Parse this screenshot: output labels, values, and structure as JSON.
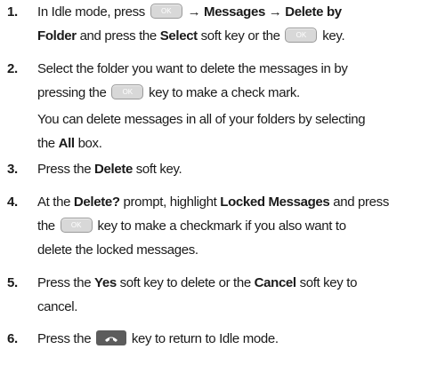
{
  "keys": {
    "ok": "OK",
    "end": "end-key-icon"
  },
  "steps": [
    {
      "num": "1.",
      "l1": {
        "a": "In Idle mode, press",
        "b": "→ Messages → Delete by"
      },
      "l2": {
        "a": "Folder",
        "b": " and press the ",
        "c": "Select",
        "d": " soft key or the ",
        "e": " key."
      }
    },
    {
      "num": "2.",
      "l1": "Select the folder you want to delete the messages in by",
      "l2": {
        "a": "pressing the ",
        "b": " key to make a check mark."
      },
      "sub1": "You can delete messages in all of your folders by selecting",
      "sub2": {
        "a": "the ",
        "b": "All",
        "c": " box."
      }
    },
    {
      "num": "3.",
      "l1": {
        "a": "Press the ",
        "b": "Delete",
        "c": " soft key."
      }
    },
    {
      "num": "4.",
      "l1": {
        "a": "At the ",
        "b": "Delete?",
        "c": " prompt, highlight ",
        "d": "Locked Messages",
        "e": " and press"
      },
      "l2": {
        "a": "the ",
        "b": " key to make a checkmark if you also want to"
      },
      "l3": "delete the locked messages."
    },
    {
      "num": "5.",
      "l1": {
        "a": "Press the ",
        "b": "Yes",
        "c": " soft key to delete or the ",
        "d": "Cancel",
        "e": " soft key to"
      },
      "l2": "cancel."
    },
    {
      "num": "6.",
      "l1": {
        "a": "Press the ",
        "b": " key to return to Idle mode."
      }
    }
  ]
}
